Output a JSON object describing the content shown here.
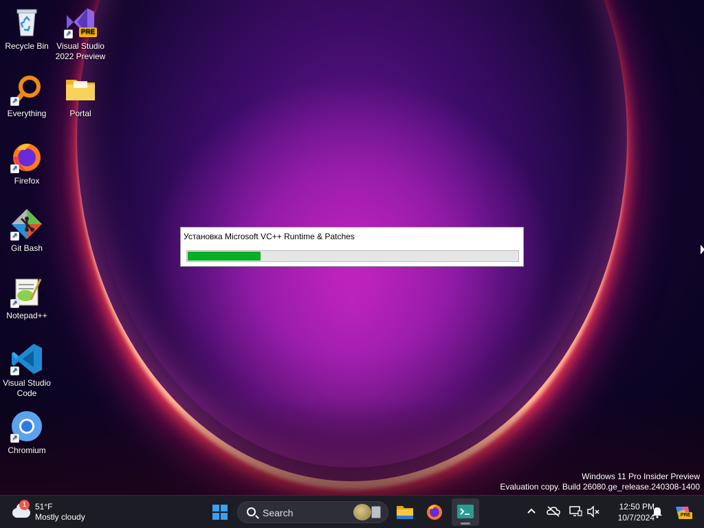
{
  "desktop": {
    "icons": [
      {
        "label": "Recycle Bin"
      },
      {
        "label": "Visual Studio 2022 Preview",
        "badge": "PRE"
      },
      {
        "label": "Everything"
      },
      {
        "label": "Portal"
      },
      {
        "label": "Firefox"
      },
      {
        "label": "Git Bash"
      },
      {
        "label": "Notepad++"
      },
      {
        "label": "Visual Studio Code"
      },
      {
        "label": "Chromium"
      }
    ],
    "watermark": {
      "line1": "Windows 11 Pro Insider Preview",
      "line2": "Evaluation copy. Build 26080.ge_release.240308-1400"
    }
  },
  "installer": {
    "title": "Установка Microsoft VC++ Runtime & Patches",
    "progress_fraction": 0.22,
    "progress_color": "#06b025"
  },
  "taskbar": {
    "weather": {
      "temperature": "51°F",
      "condition": "Mostly cloudy",
      "badge": "1"
    },
    "search_label": "Search",
    "pinned": [
      "windows-start-icon",
      "file-explorer-icon",
      "firefox-icon",
      "terminal-icon"
    ],
    "tray": [
      "chevron-up-icon",
      "onedrive-offline-icon",
      "display-icon",
      "speaker-muted-icon"
    ],
    "clock": {
      "time": "12:50 PM",
      "date": "10/7/2024"
    },
    "copilot_badge": "PRE"
  },
  "colors": {
    "taskbar_bg": "#1c1c24",
    "accent_blue": "#3aa0f2"
  }
}
